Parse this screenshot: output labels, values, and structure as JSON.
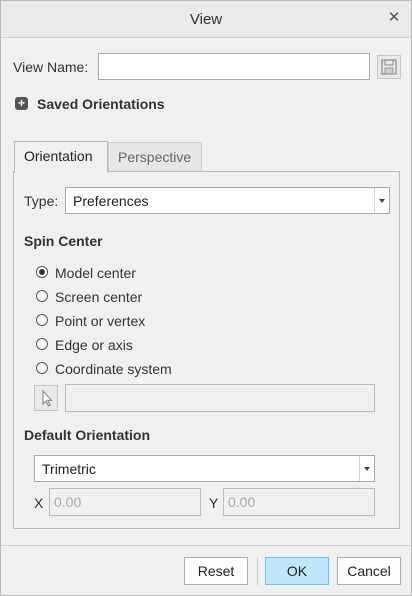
{
  "window": {
    "title": "View"
  },
  "view_name": {
    "label": "View Name:",
    "value": ""
  },
  "saved_orientations": {
    "label": "Saved Orientations"
  },
  "tabs": [
    {
      "label": "Orientation",
      "active": true
    },
    {
      "label": "Perspective",
      "active": false
    }
  ],
  "type": {
    "label": "Type:",
    "value": "Preferences"
  },
  "spin_center": {
    "heading": "Spin Center",
    "options": [
      {
        "label": "Model center",
        "selected": true
      },
      {
        "label": "Screen center",
        "selected": false
      },
      {
        "label": "Point or vertex",
        "selected": false
      },
      {
        "label": "Edge or axis",
        "selected": false
      },
      {
        "label": "Coordinate system",
        "selected": false
      }
    ],
    "selection_value": ""
  },
  "default_orientation": {
    "heading": "Default Orientation",
    "value": "Trimetric",
    "x_label": "X",
    "x_placeholder": "0.00",
    "y_label": "Y",
    "y_placeholder": "0.00"
  },
  "buttons": {
    "reset": "Reset",
    "ok": "OK",
    "cancel": "Cancel"
  },
  "icons": {
    "close": "close-icon",
    "save": "floppy-disk-icon",
    "expand": "plus-expand-icon",
    "pick": "cursor-arrow-icon"
  }
}
